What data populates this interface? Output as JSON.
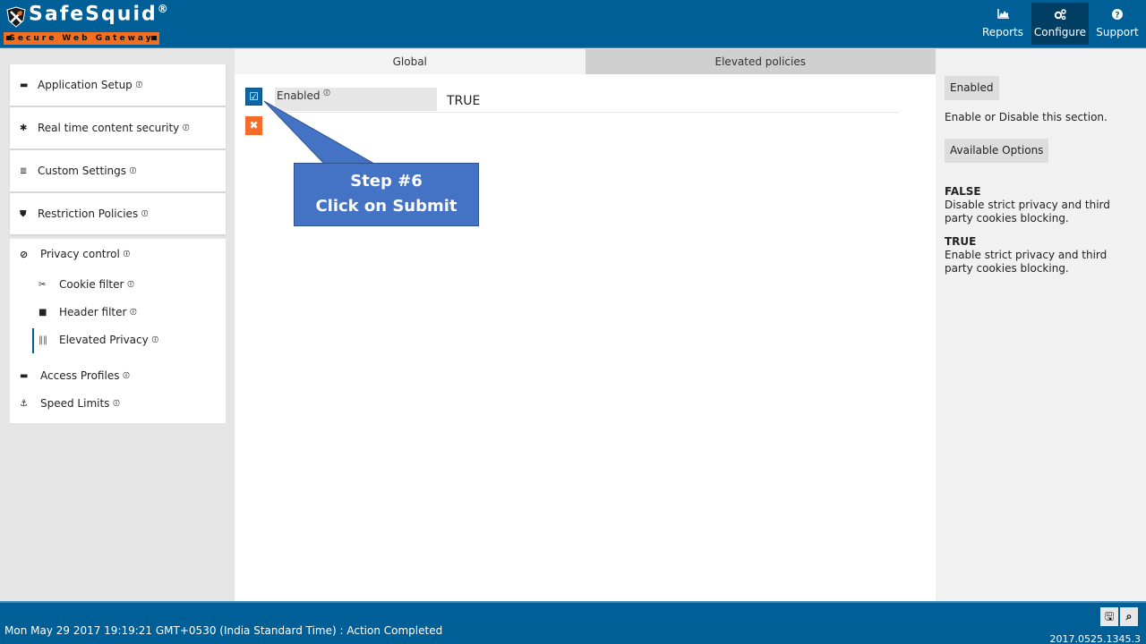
{
  "header": {
    "logo": {
      "name": "SafeSquid",
      "registered": "®",
      "tagline": "Secure Web Gateway"
    },
    "nav": [
      {
        "label": "Reports",
        "icon": "area-chart-icon",
        "active": false
      },
      {
        "label": "Configure",
        "icon": "cogs-icon",
        "active": true
      },
      {
        "label": "Support",
        "icon": "question-circle-icon",
        "active": false
      }
    ]
  },
  "sidebar": {
    "panels": [
      {
        "label": "Application Setup",
        "icon": "briefcase-icon"
      },
      {
        "label": "Real time content security",
        "icon": "bug-icon"
      },
      {
        "label": "Custom Settings",
        "icon": "sliders-icon"
      },
      {
        "label": "Restriction Policies",
        "icon": "shield-icon"
      }
    ],
    "tree": {
      "parent": {
        "label": "Privacy control",
        "icon": "ban-icon"
      },
      "children": [
        {
          "label": "Cookie filter",
          "icon": "scissors-icon"
        },
        {
          "label": "Header filter",
          "icon": "lock-icon"
        },
        {
          "label": "Elevated Privacy",
          "icon": "barcode-icon",
          "active": true
        }
      ],
      "siblings": [
        {
          "label": "Access Profiles",
          "icon": "briefcase-icon"
        },
        {
          "label": "Speed Limits",
          "icon": "anchor-icon"
        }
      ]
    }
  },
  "main": {
    "tabs": [
      {
        "label": "Global",
        "active": true
      },
      {
        "label": "Elevated policies",
        "active": false
      }
    ],
    "field": {
      "label": "Enabled",
      "value": "TRUE"
    },
    "buttons": {
      "submit": "submit-icon",
      "cancel": "cancel-icon"
    }
  },
  "callout": {
    "line1": "Step #6",
    "line2": "Click on Submit"
  },
  "help": {
    "title": "Enabled",
    "description": "Enable or Disable this section.",
    "options_heading": "Available Options",
    "options": [
      {
        "name": "FALSE",
        "desc": "Disable strict privacy and third party cookies blocking."
      },
      {
        "name": "TRUE",
        "desc": "Enable strict privacy and third party cookies blocking."
      }
    ]
  },
  "footer": {
    "status": "Mon May 29 2017 19:19:21 GMT+0530 (India Standard Time) : Action Completed",
    "version": "2017.0525.1345.3",
    "buttons": [
      {
        "icon": "save-icon"
      },
      {
        "icon": "search-icon"
      }
    ]
  },
  "colors": {
    "brand": "#005f96",
    "accent": "#f26f21",
    "callout": "#4472c4"
  }
}
